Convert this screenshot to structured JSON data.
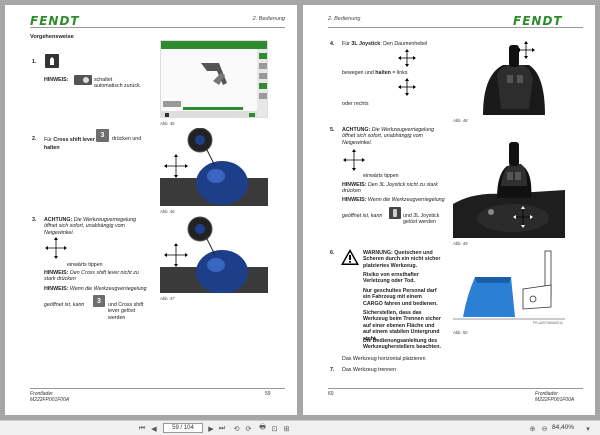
{
  "brand": "FENDT",
  "left_page": {
    "chapter": "2. Bedienung",
    "section_title": "Vorgehensweise",
    "step1": {
      "num": "1.",
      "hint_label": "HINWEIS:",
      "hint_text": "schaltet automatisch zurück."
    },
    "fig45": "Abb. 45",
    "step2": {
      "num": "2.",
      "text_a": "Für ",
      "bold_a": "Cross shift lever",
      "key": "3",
      "text_b": " drücken und ",
      "bold_b": "halten"
    },
    "fig46": "Abb. 46",
    "step3": {
      "num": "3.",
      "achtung_label": "ACHTUNG:",
      "achtung_text": "Die Werkzeugverriegelung öffnet sich sofort, unabhängig vom Neigewinkel.",
      "move_text": "einwärts tippen",
      "hint1_label": "HINWEIS:",
      "hint1_text": "Den Cross shift lever nicht zu stark drücken",
      "hint2_label": "HINWEIS:",
      "hint2_text": "Wenn die Werkzeugverriegelung",
      "tail_a": "geöffnet ist, kann",
      "key": "3",
      "tail_b": "und Cross shift lever gelöst werden"
    },
    "fig47": "Abb. 47",
    "footer_line1": "Frontlader",
    "footer_line2": "M222FP001F00A",
    "page_number": "59"
  },
  "right_page": {
    "chapter": "2. Bedienung",
    "step4": {
      "num": "4.",
      "text_a": "Für ",
      "bold_a": "3L Joystick",
      "text_b": ": Den Daumenhebel",
      "line2": "bewegen und ",
      "bold_b": "halten",
      "line2b": " = links",
      "line3": "oder rechts"
    },
    "fig48": "Abb. 48",
    "step5": {
      "num": "5.",
      "achtung_label": "ACHTUNG:",
      "achtung_text": "Die Werkzeugverriegelung öffnet sich sofort, unabhängig vom Neigewinkel.",
      "move_text": "einwärts tippen",
      "hint1_label": "HINWEIS:",
      "hint1_text": "Den 3L Joystick nicht zu stark drücken",
      "hint2_label": "HINWEIS:",
      "hint2_text": "Wenn die Werkzeugverriegelung",
      "tail_a": "geöffnet ist, kann",
      "tail_b": "und 3L Joystick gelöst werden"
    },
    "fig49": "Abb. 49",
    "step6": {
      "num": "6.",
      "warn_title": "WARNUNG: Quetschen und Scheren durch ein nicht sicher platziertes Werkzeug.",
      "warn_risk": "Risiko von ernsthafter Verletzung oder Tod.",
      "warn_p1": "Nur geschultes Personal darf ein Fahrzeug mit einem CARGO fahren und bedienen.",
      "warn_p2": "Sicherstellen, dass das Werkzeug beim Trennen sicher auf einer ebenen Fläche und auf einem stabilen Untergrund steht.",
      "warn_p3": "Die Bedienungsanleitung des Werkzeugherstellers beachten.",
      "after": "Das Werkzeug horizontal platzieren"
    },
    "fig50": "Abb. 50",
    "fig50_code": "FR-A007060A0012",
    "step7": {
      "num": "7.",
      "text": "Das Werkzeug trennen"
    },
    "footer_line1": "Frontlader",
    "footer_line2": "M222FP001F00A",
    "page_number": "60"
  },
  "toolbar": {
    "page_current": "59",
    "page_total": "104",
    "page_display": "59 / 104",
    "zoom": "84,40%"
  }
}
